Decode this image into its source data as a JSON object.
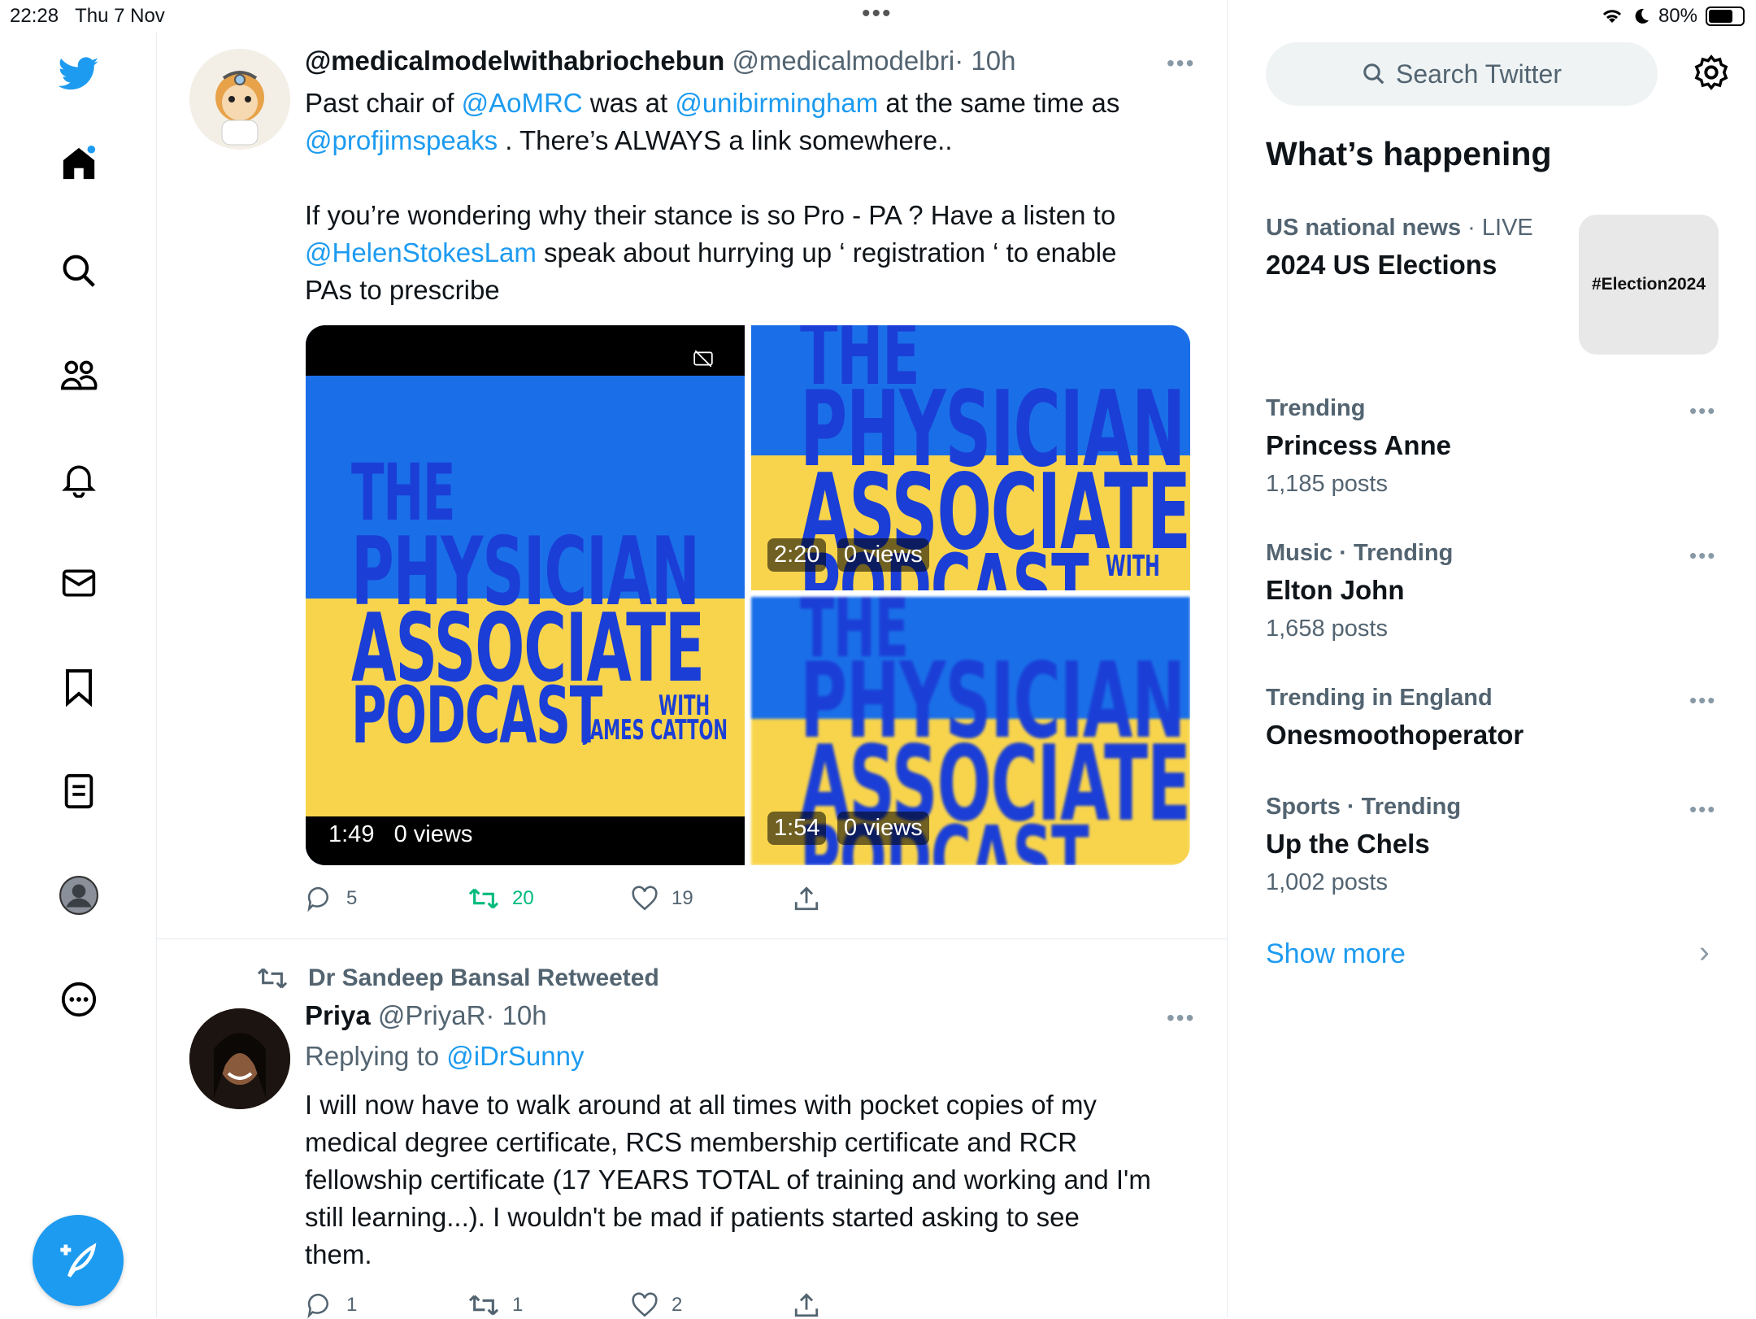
{
  "status_bar": {
    "time": "22:28",
    "date": "Thu 7 Nov",
    "battery": "80%",
    "battery_level": 0.8,
    "center_dots": "•••"
  },
  "colors": {
    "accent": "#1d9bf0",
    "retweet": "#00ba7c",
    "text": "#0f1419",
    "muted": "#536471"
  },
  "nav": {
    "items": [
      "twitter-logo-icon",
      "home-icon",
      "search-icon",
      "communities-icon",
      "notifications-icon",
      "messages-icon",
      "bookmarks-icon",
      "lists-icon",
      "profile-icon",
      "more-icon"
    ],
    "compose_icon": "compose-icon"
  },
  "tweets": [
    {
      "display_name": "@medicalmodelwithabriochebun",
      "handle": "@medicalmodelbri",
      "time": "· 10h",
      "more": "•••",
      "body": {
        "m1": "@AoMRC",
        "t1": "Past chair of ",
        "t2": " was at ",
        "m2": "@unibirmingham",
        "t3": " at the same time as",
        "m3": "@profjimspeaks",
        "t4": " . There’s ALWAYS a link somewhere..",
        "l3": "If you’re wondering why their stance is so Pro - PA ?  Have a listen to",
        "m4": "@HelenStokesLam",
        "t5": " speak about hurrying up ‘ registration ‘ to enable",
        "l5": "PAs to prescribe"
      },
      "media": [
        {
          "duration": "1:49",
          "views": "0 views"
        },
        {
          "duration": "2:20",
          "views": "0 views"
        },
        {
          "duration": "1:54",
          "views": "0 views"
        }
      ],
      "podcast": {
        "l1": "THE",
        "l2": "PHYSICIAN",
        "l3": "ASSOCIATE",
        "l4": "PODCAST",
        "with": "WITH",
        "host": "JAMES CATTON"
      },
      "actions": {
        "replies": "5",
        "retweets": "20",
        "likes": "19"
      }
    },
    {
      "retweeted_by": "Dr Sandeep Bansal Retweeted",
      "display_name": "Priya",
      "handle": "@PriyaR",
      "time": "· 10h",
      "more": "•••",
      "replying_prefix": "Replying to ",
      "replying_to": "@iDrSunny",
      "lines": [
        "I will now have to walk around at all times with pocket copies of my",
        "medical degree certificate, RCS membership certificate and RCR",
        "fellowship certificate (17 YEARS TOTAL of training and working and I'm",
        "still learning...). I wouldn't be mad if patients started asking to see",
        "them."
      ],
      "actions": {
        "replies": "1",
        "retweets": "1",
        "likes": "2"
      }
    }
  ],
  "sidebar": {
    "search_placeholder": "Search Twitter",
    "heading": "What’s happening",
    "featured": {
      "category": "US national news",
      "live": " · LIVE",
      "title": "2024 US Elections",
      "tag": "#Election2024"
    },
    "trends": [
      {
        "meta": "Trending",
        "name": "Princess Anne",
        "posts": "1,185 posts"
      },
      {
        "meta": "Music · Trending",
        "name": "Elton John",
        "posts": "1,658 posts"
      },
      {
        "meta": "Trending in England",
        "name": "Onesmoothoperator",
        "posts": ""
      },
      {
        "meta": "Sports · Trending",
        "name": "Up the Chels",
        "posts": "1,002 posts"
      }
    ],
    "trend_more": "•••",
    "show_more": "Show more",
    "chevron": "›"
  }
}
